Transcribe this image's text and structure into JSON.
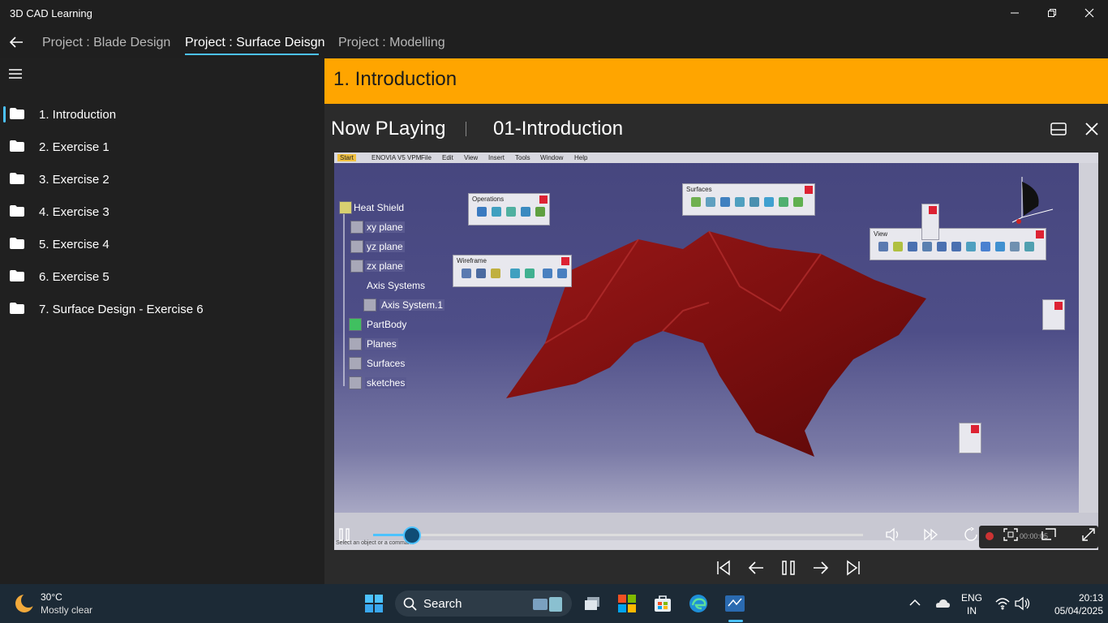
{
  "window": {
    "title": "3D CAD Learning"
  },
  "projects": {
    "tabs": [
      {
        "label": "Project : Blade Design"
      },
      {
        "label": "Project : Surface Deisgn"
      },
      {
        "label": "Project : Modelling"
      }
    ],
    "active_index": 1
  },
  "sidebar": {
    "items": [
      {
        "label": "1. Introduction"
      },
      {
        "label": "2. Exercise 1"
      },
      {
        "label": "3. Exercise 2"
      },
      {
        "label": "4. Exercise 3"
      },
      {
        "label": "5. Exercise 4"
      },
      {
        "label": "6. Exercise 5"
      },
      {
        "label": "7. Surface Design - Exercise 6"
      }
    ],
    "selected_index": 0
  },
  "section": {
    "title": "1. Introduction",
    "accent_color": "#ffa500"
  },
  "now_playing": {
    "label": "Now PLaying",
    "video_name": "01-Introduction"
  },
  "video": {
    "catia_menu": [
      "Start",
      "ENOVIA V5 VPM",
      "File",
      "Edit",
      "View",
      "Insert",
      "Tools",
      "Window",
      "Help"
    ],
    "tree": [
      "Heat Shield",
      "xy plane",
      "yz plane",
      "zx plane",
      "Axis Systems",
      "Axis System.1",
      "PartBody",
      "Planes",
      "Surfaces",
      "sketches"
    ],
    "toolbars": {
      "operations": "Operations",
      "wireframe": "Wireframe",
      "surfaces": "Surfaces",
      "view": "View"
    },
    "status_text": "Select an object or a command",
    "rec_time": "00:00:05",
    "seek_progress": 0.08
  },
  "taskbar": {
    "weather": {
      "temp": "30°C",
      "desc": "Mostly clear"
    },
    "search_label": "Search",
    "language": {
      "line1": "ENG",
      "line2": "IN"
    },
    "clock": {
      "time": "20:13",
      "date": "05/04/2025"
    }
  }
}
